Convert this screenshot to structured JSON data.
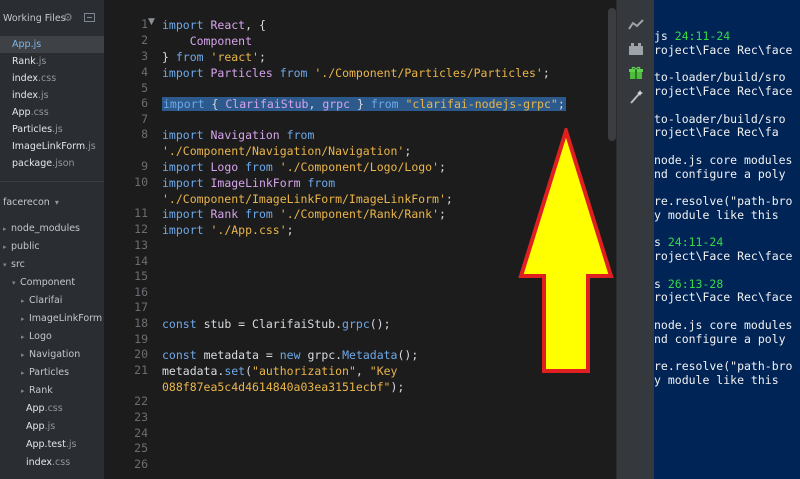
{
  "sidebar": {
    "working_files_title": "Working Files",
    "working_files": [
      {
        "name": "App",
        "ext": ".js",
        "selected": true
      },
      {
        "name": "Rank",
        "ext": ".js"
      },
      {
        "name": "index",
        "ext": ".css"
      },
      {
        "name": "index",
        "ext": ".js"
      },
      {
        "name": "App",
        "ext": ".css"
      },
      {
        "name": "Particles",
        "ext": ".js"
      },
      {
        "name": "ImageLinkForm",
        "ext": ".js"
      },
      {
        "name": "package",
        "ext": ".json"
      }
    ],
    "project_name": "facerecon",
    "tree": [
      {
        "name": "node_modules",
        "ext": "",
        "indent": 0,
        "type": "folder"
      },
      {
        "name": "public",
        "ext": "",
        "indent": 0,
        "type": "folder"
      },
      {
        "name": "src",
        "ext": "",
        "indent": 0,
        "type": "folder-open"
      },
      {
        "name": "Component",
        "ext": "",
        "indent": 1,
        "type": "folder-open"
      },
      {
        "name": "Clarifai",
        "ext": "",
        "indent": 2,
        "type": "folder"
      },
      {
        "name": "ImageLinkForm",
        "ext": "",
        "indent": 2,
        "type": "folder"
      },
      {
        "name": "Logo",
        "ext": "",
        "indent": 2,
        "type": "folder"
      },
      {
        "name": "Navigation",
        "ext": "",
        "indent": 2,
        "type": "folder"
      },
      {
        "name": "Particles",
        "ext": "",
        "indent": 2,
        "type": "folder"
      },
      {
        "name": "Rank",
        "ext": "",
        "indent": 2,
        "type": "folder"
      },
      {
        "name": "App",
        "ext": ".css",
        "indent": 1,
        "type": "file"
      },
      {
        "name": "App",
        "ext": ".js",
        "indent": 1,
        "type": "file"
      },
      {
        "name": "App.test",
        "ext": ".js",
        "indent": 1,
        "type": "file"
      },
      {
        "name": "index",
        "ext": ".css",
        "indent": 1,
        "type": "file"
      }
    ]
  },
  "editor": {
    "line_numbers": [
      "1",
      "2",
      "3",
      "4",
      "5",
      "6",
      "7",
      "8",
      "",
      "9",
      "10",
      "",
      "11",
      "12",
      "13",
      "14",
      "15",
      "16",
      "17",
      "18",
      "19",
      "20",
      "21",
      "",
      "22",
      "23",
      "24",
      "25",
      "26"
    ],
    "code": {
      "l1_kw": "import",
      "l1_id": "React",
      "l1_pn": ", {",
      "l2_id": "Component",
      "l3_pn1": "}",
      "l3_kw": "from",
      "l3_str": "'react'",
      "l3_pn2": ";",
      "l4_kw": "import",
      "l4_id": "Particles",
      "l4_kw2": "from",
      "l4_str": "'./Component/Particles/Particles'",
      "l4_pn": ";",
      "l6_kw": "import",
      "l6_pn1": "{",
      "l6_id1": "ClarifaiStub",
      "l6_pn2": ",",
      "l6_id2": "grpc",
      "l6_pn3": "}",
      "l6_kw2": "from",
      "l6_str": "\"clarifai-nodejs-grpc\"",
      "l6_pn4": ";",
      "l8_kw": "import",
      "l8_id": "Navigation",
      "l8_kw2": "from",
      "l8b_str": "'./Component/Navigation/Navigation'",
      "l8b_pn": ";",
      "l9_kw": "import",
      "l9_id": "Logo",
      "l9_kw2": "from",
      "l9_str": "'./Component/Logo/Logo'",
      "l9_pn": ";",
      "l10_kw": "import",
      "l10_id": "ImageLinkForm",
      "l10_kw2": "from",
      "l10b_str": "'./Component/ImageLinkForm/ImageLinkForm'",
      "l10b_pn": ";",
      "l11_kw": "import",
      "l11_id": "Rank",
      "l11_kw2": "from",
      "l11_str": "'./Component/Rank/Rank'",
      "l11_pn": ";",
      "l12_kw": "import",
      "l12_str": "'./App.css'",
      "l12_pn": ";",
      "l18_kw": "const",
      "l18_pn1": "stub = ClarifaiStub.",
      "l18_fn": "grpc",
      "l18_pn2": "();",
      "l20_kw": "const",
      "l20_pn1": "metadata =",
      "l20_kw2": "new",
      "l20_pn2": "grpc.",
      "l20_fn": "Metadata",
      "l20_pn3": "();",
      "l21_pn1": "metadata.",
      "l21_fn": "set",
      "l21_pn2": "(",
      "l21_str": "\"authorization\"",
      "l21_pn3": ",",
      "l21_str2": "\"Key",
      "l21b_str": "088f87ea5c4d4614840a03ea3151ecbf\"",
      "l21b_pn": ");"
    }
  },
  "terminal": {
    "lines": [
      {
        "text": "js ",
        "time": "24:11-24"
      },
      {
        "text": "roject\\Face Rec\\face"
      },
      {
        "text": ""
      },
      {
        "text": "to-loader/build/sro"
      },
      {
        "text": "roject\\Face Rec\\face"
      },
      {
        "text": ""
      },
      {
        "text": "to-loader/build/sro"
      },
      {
        "text": "roject\\Face Rec\\fa"
      },
      {
        "text": ""
      },
      {
        "text": "node.js core modules"
      },
      {
        "text": "nd configure a poly"
      },
      {
        "text": ""
      },
      {
        "text": "re.resolve(\"path-bro"
      },
      {
        "text": "y module like this"
      },
      {
        "text": ""
      },
      {
        "text": "s ",
        "time": "24:11-24"
      },
      {
        "text": "roject\\Face Rec\\face"
      },
      {
        "text": ""
      },
      {
        "text": "s ",
        "time": "26:13-28"
      },
      {
        "text": "roject\\Face Rec\\face"
      },
      {
        "text": ""
      },
      {
        "text": "node.js core modules"
      },
      {
        "text": "nd configure a poly"
      },
      {
        "text": ""
      },
      {
        "text": "re.resolve(\"path-bro"
      },
      {
        "text": "y module like this"
      }
    ]
  },
  "toolstrip": {
    "icons": [
      "live-preview-icon",
      "extension-manager-icon",
      "gift-icon",
      "magic-wand-icon"
    ]
  },
  "annotation": {
    "arrow_color": "#ffff00",
    "arrow_outline": "#e02020"
  }
}
